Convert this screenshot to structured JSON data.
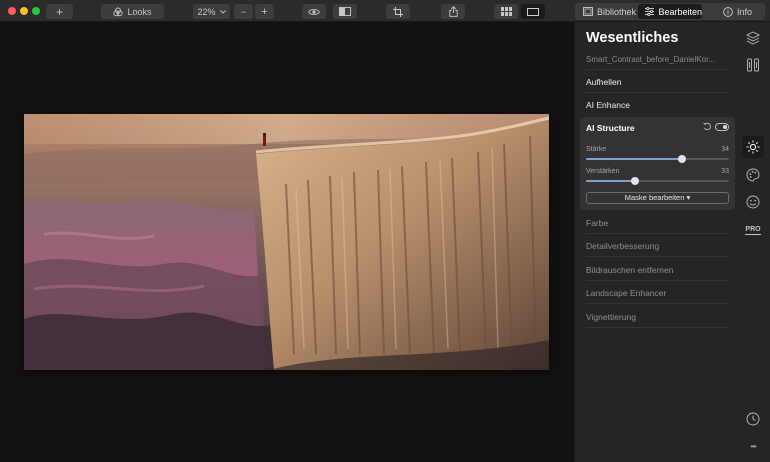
{
  "toolbar": {
    "looks_label": "Looks",
    "zoom_value": "22%",
    "zoom_out_label": "−",
    "zoom_in_label": "+",
    "add_label": "+",
    "tabs": [
      {
        "label": "Bibliothek",
        "icon": "library-icon"
      },
      {
        "label": "Bearbeiten",
        "icon": "sliders-icon"
      },
      {
        "label": "Info",
        "icon": "info-icon"
      }
    ]
  },
  "panel": {
    "title": "Wesentliches",
    "filename": "Smart_Contrast_before_DanielKor...",
    "items_top": [
      "Aufhellen",
      "AI Enhance"
    ],
    "ai_structure": {
      "title": "AI Structure",
      "enabled": true,
      "sliders": [
        {
          "label": "Stärke",
          "value": "34",
          "level": 0.67
        },
        {
          "label": "Verstärken",
          "value": "33",
          "level": 0.34
        }
      ],
      "mask_button": "Maske bearbeiten ▾"
    },
    "items_bottom": [
      "Farbe",
      "Detailverbesserung",
      "Bildrauschen entfernen",
      "Landscape Enhancer",
      "Vignettierung"
    ]
  },
  "strip": {
    "pro_label": "PRO",
    "more_label": "•••"
  },
  "colors": {
    "accent": "#7ea2d4",
    "panel_bg": "#252525",
    "canvas_bg": "#121212"
  }
}
